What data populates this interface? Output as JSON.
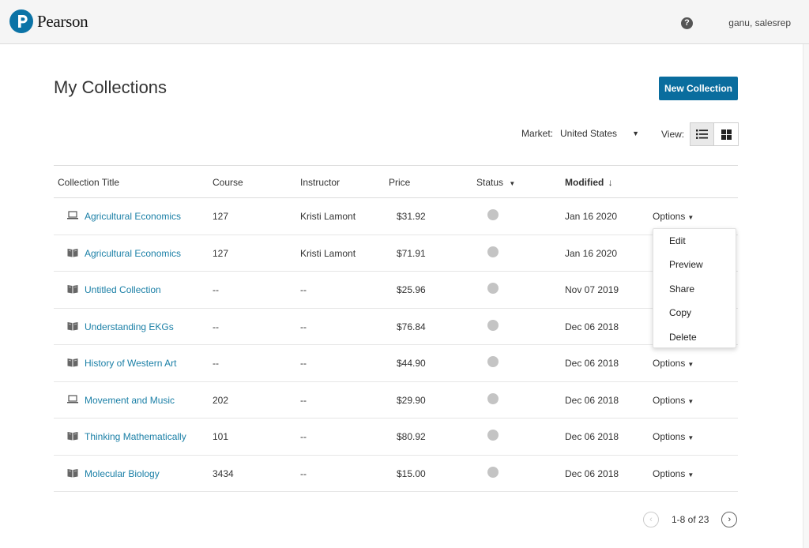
{
  "header": {
    "brand": "Pearson",
    "help_glyph": "?",
    "user": "ganu, salesrep"
  },
  "page": {
    "title": "My Collections",
    "new_button": "New Collection"
  },
  "filters": {
    "market_label": "Market:",
    "market_value": "United States",
    "view_label": "View:"
  },
  "table": {
    "columns": {
      "title": "Collection Title",
      "course": "Course",
      "instructor": "Instructor",
      "price": "Price",
      "status": "Status",
      "modified": "Modified"
    },
    "rows": [
      {
        "icon": "laptop-icon",
        "title": "Agricultural Economics",
        "course": "127",
        "instructor": "Kristi Lamont",
        "price": "$31.92",
        "modified": "Jan 16 2020",
        "options": "Options"
      },
      {
        "icon": "book-icon",
        "title": "Agricultural Economics",
        "course": "127",
        "instructor": "Kristi Lamont",
        "price": "$71.91",
        "modified": "Jan 16 2020",
        "options": ""
      },
      {
        "icon": "book-icon",
        "title": "Untitled Collection",
        "course": "--",
        "instructor": "--",
        "price": "$25.96",
        "modified": "Nov 07 2019",
        "options": ""
      },
      {
        "icon": "book-icon",
        "title": "Understanding EKGs",
        "course": "--",
        "instructor": "--",
        "price": "$76.84",
        "modified": "Dec 06 2018",
        "options": ""
      },
      {
        "icon": "book-icon",
        "title": "History of Western Art",
        "course": "--",
        "instructor": "--",
        "price": "$44.90",
        "modified": "Dec 06 2018",
        "options": "Options"
      },
      {
        "icon": "laptop-icon",
        "title": "Movement and Music",
        "course": "202",
        "instructor": "--",
        "price": "$29.90",
        "modified": "Dec 06 2018",
        "options": "Options"
      },
      {
        "icon": "book-icon",
        "title": "Thinking Mathematically",
        "course": "101",
        "instructor": "--",
        "price": "$80.92",
        "modified": "Dec 06 2018",
        "options": "Options"
      },
      {
        "icon": "book-icon",
        "title": "Molecular Biology",
        "course": "3434",
        "instructor": "--",
        "price": "$15.00",
        "modified": "Dec 06 2018",
        "options": "Options"
      }
    ]
  },
  "menu": {
    "items": [
      "Edit",
      "Preview",
      "Share",
      "Copy",
      "Delete"
    ]
  },
  "pagination": {
    "range": "1-8 of 23"
  },
  "colors": {
    "brand": "#0b73a6",
    "primary_button": "#0a6d9e",
    "link": "#1a7fa6",
    "status_dot": "#c4c4c4"
  }
}
